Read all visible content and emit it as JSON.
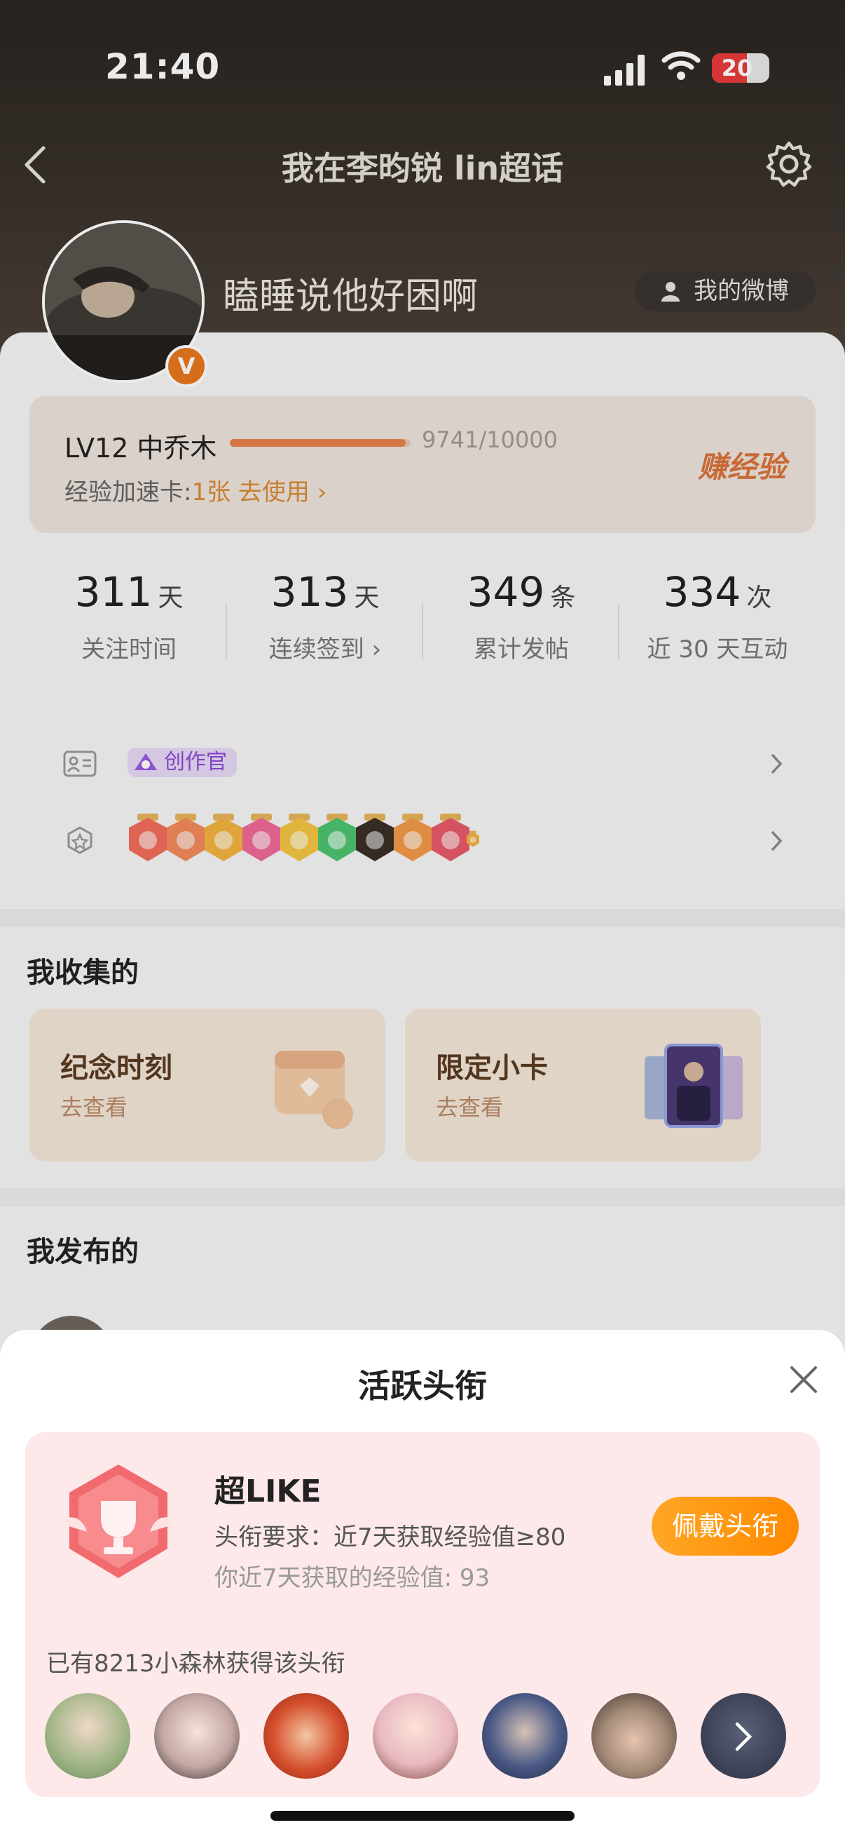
{
  "status_bar": {
    "time": "21:40",
    "battery": "20"
  },
  "nav": {
    "title": "我在李昀锐 lin超话",
    "back_icon": "chevron-left-icon",
    "settings_icon": "gear-icon"
  },
  "profile": {
    "username": "瞌睡说他好困啊",
    "my_weibo_label": "我的微博",
    "badge_letter": "V"
  },
  "level": {
    "name": "LV12 中乔木",
    "exp": "9741/10000",
    "progress": 0.9741,
    "speed_card_prefix": "经验加速卡:",
    "speed_card_value": "1张 去使用",
    "earn_label": "赚经验"
  },
  "stats": [
    {
      "value": "311",
      "unit": "天",
      "label": "关注时间"
    },
    {
      "value": "313",
      "unit": "天",
      "label": "连续签到"
    },
    {
      "value": "349",
      "unit": "条",
      "label": "累计发帖"
    },
    {
      "value": "334",
      "unit": "次",
      "label": "近 30 天互动"
    }
  ],
  "creator_tag": "创作官",
  "sections": {
    "collected": "我收集的",
    "published": "我发布的"
  },
  "collections": [
    {
      "title": "纪念时刻",
      "action": "去查看"
    },
    {
      "title": "限定小卡",
      "action": "去查看"
    }
  ],
  "sheet": {
    "title": "活跃头衔",
    "title_name": "超LIKE",
    "requirement": "头衔要求：近7天获取经验值≥80",
    "mine": "你近7天获取的经验值: 93",
    "wear_button": "佩戴头衔",
    "holders": "已有8213小森林获得该头衔"
  },
  "colors": {
    "accent": "#e6824a",
    "wear": "#ff9a14",
    "panel": "#fde9ea"
  }
}
